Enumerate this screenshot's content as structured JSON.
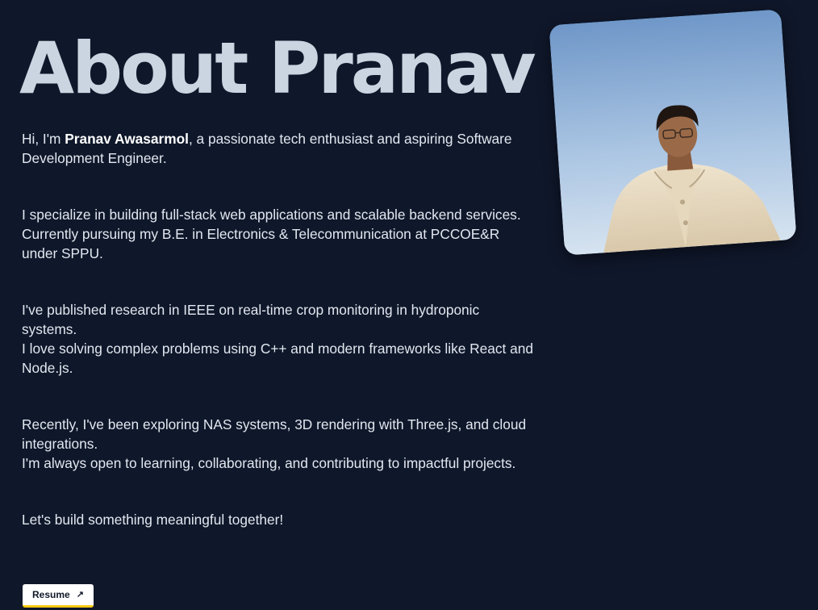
{
  "about": {
    "heading": "About Pranav",
    "intro_prefix": "Hi, I'm ",
    "intro_name": "Pranav Awasarmol",
    "intro_suffix": ", a passionate tech enthusiast and aspiring Software Development Engineer.",
    "p2_line1": "I specialize in building full-stack web applications and scalable backend services.",
    "p2_line2": "Currently pursuing my B.E. in Electronics & Telecommunication at PCCOE&R under SPPU.",
    "p3_line1": "I've published research in IEEE on real-time crop monitoring in hydroponic systems.",
    "p3_line2": "I love solving complex problems using C++ and modern frameworks like React and Node.js.",
    "p4_line1": "Recently, I've been exploring NAS systems, 3D rendering with Three.js, and cloud integrations.",
    "p4_line2": "I'm always open to learning, collaborating, and contributing to impactful projects.",
    "closing": "Let's build something meaningful together!"
  },
  "resume_button": {
    "label": "Resume",
    "icon": "arrow-up-right-icon"
  },
  "colors": {
    "background": "#0f172a",
    "heading": "#cbd5e1",
    "text": "#e2e8f0",
    "button_bg": "#ffffff",
    "button_accent": "#facc15"
  }
}
